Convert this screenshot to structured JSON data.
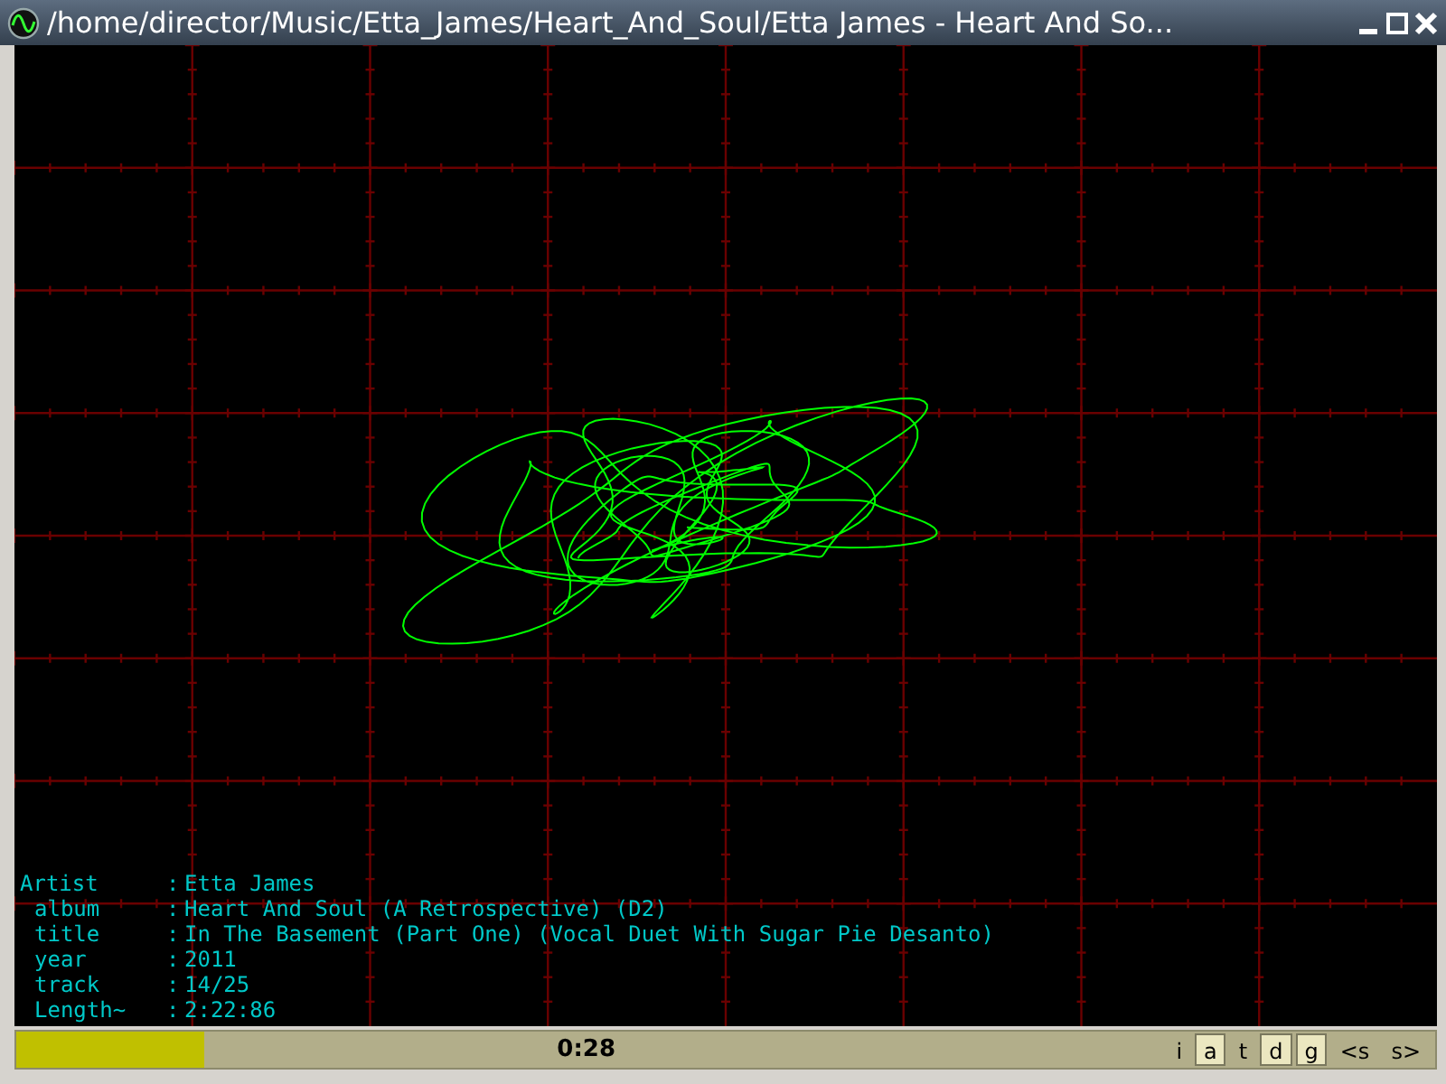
{
  "window": {
    "title": "/home/director/Music/Etta_James/Heart_And_Soul/Etta James - Heart And So..."
  },
  "track_info": [
    {
      "label": "Artist",
      "separator": ":",
      "value": "Etta James"
    },
    {
      "label": "album",
      "separator": ":",
      "value": "Heart And Soul (A Retrospective) (D2)"
    },
    {
      "label": "title",
      "separator": ":",
      "value": "In The Basement (Part One) (Vocal Duet With Sugar Pie Desanto)"
    },
    {
      "label": "year",
      "separator": ":",
      "value": "2011"
    },
    {
      "label": "track",
      "separator": ":",
      "value": "14/25"
    },
    {
      "label": "Length~",
      "separator": ":",
      "value": "2:22:86"
    }
  ],
  "status_bar": {
    "progress": {
      "level": 0.165
    },
    "time": "0:28",
    "buttons": [
      {
        "label": "i",
        "selected": false
      },
      {
        "label": "a",
        "selected": true
      },
      {
        "label": "t",
        "selected": false
      },
      {
        "label": "d",
        "selected": true
      },
      {
        "label": "g",
        "selected": true
      },
      {
        "label": "<s",
        "selected": false
      },
      {
        "label": "s>",
        "selected": false
      }
    ]
  }
}
